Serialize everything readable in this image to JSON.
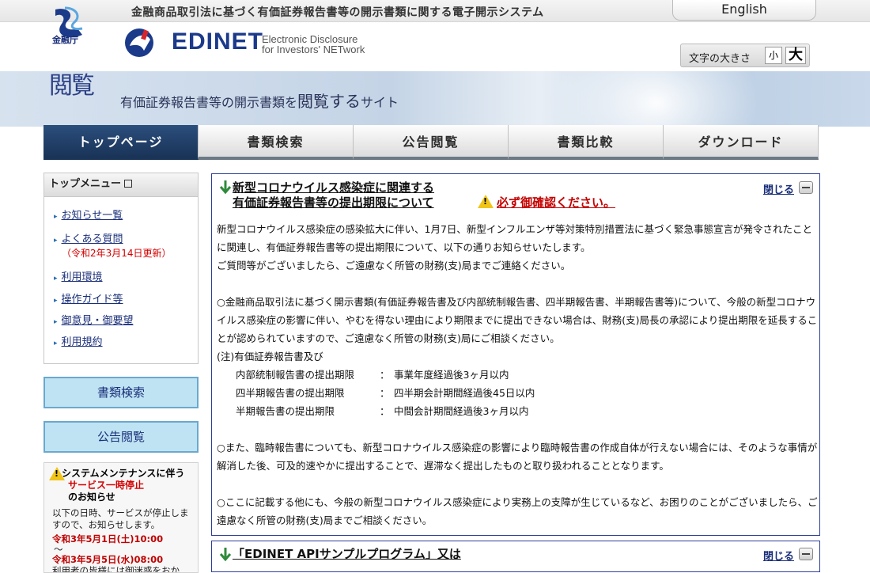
{
  "header": {
    "system_title": "金融商品取引法に基づく有価証券報告書等の開示書類に関する電子開示システム",
    "fsa_label": "金融庁",
    "logo_name": "EDINET",
    "logo_sub_line1": "Electronic Disclosure",
    "logo_sub_line2": "for Investors' NETwork",
    "english_link": "English",
    "font_size_label": "文字の大きさ",
    "font_small": "小",
    "font_large": "大"
  },
  "banner": {
    "kanji": "閲覧",
    "tagline_pre": "有価証券報告書等の開示書類を",
    "tagline_big": "閲覧する",
    "tagline_post": "サイト"
  },
  "nav": {
    "tabs": [
      "トップページ",
      "書類検索",
      "公告閲覧",
      "書類比較",
      "ダウンロード"
    ]
  },
  "sidebar": {
    "top_menu_title": "トップメニュー",
    "items": [
      "お知らせ一覧",
      "よくある質問",
      "利用環境",
      "操作ガイド等",
      "御意見・御要望",
      "利用規約"
    ],
    "faq_note": "（令和2年3月14日更新）",
    "search_button": "書類検索",
    "koukoku_button": "公告閲覧",
    "maintenance": {
      "title1": "システムメンテナンスに伴う",
      "title2": "サービス一時停止",
      "title3": "のお知らせ",
      "body": "以下の日時、サービスが停止しますので、お知らせします。",
      "date1": "令和3年5月1日(土)10:00",
      "tilde": "～",
      "date2": "令和3年5月5日(水)08:00",
      "tail": "利用者の皆様には御迷惑をおか"
    }
  },
  "notice1": {
    "title_line1": "新型コロナウイルス感染症に関連する",
    "title_line2": "有価証券報告書等の提出期限について",
    "confirm": "必ず御確認ください。",
    "close": "閉じる",
    "para1": "新型コロナウイルス感染症の感染拡大に伴い、1月7日、新型インフルエンザ等対策特別措置法に基づく緊急事態宣言が発令されたことに関連し、有価証券報告書等の提出期限について、以下の通りお知らせいたします。",
    "para1b": "ご質問等がございましたら、ご遠慮なく所管の財務(支)局までご連絡ください。",
    "para2": "○金融商品取引法に基づく開示書類(有価証券報告書及び内部統制報告書、四半期報告書、半期報告書等)について、今般の新型コロナウイルス感染症の影響に伴い、やむを得ない理由により期限までに提出できない場合は、財務(支)局長の承認により提出期限を延長することが認められていますので、ご遠慮なく所管の財務(支)局にご相談ください。",
    "note_head": "(注)有価証券報告書及び",
    "deadlines": [
      {
        "label": "内部統制報告書の提出期限",
        "colon": "：",
        "value": "事業年度経過後3ヶ月以内"
      },
      {
        "label": "四半期報告書の提出期限",
        "colon": "：",
        "value": "四半期会計期間経過後45日以内"
      },
      {
        "label": "半期報告書の提出期限",
        "colon": "：",
        "value": "中間会計期間経過後3ヶ月以内"
      }
    ],
    "para3": "○また、臨時報告書についても、新型コロナウイルス感染症の影響により臨時報告書の作成自体が行えない場合には、そのような事情が解消した後、可及的速やかに提出することで、遅滞なく提出したものと取り扱われることとなります。",
    "para4": "○ここに記載する他にも、今般の新型コロナウイルス感染症により実務上の支障が生じているなど、お困りのことがございましたら、ご遠慮なく所管の財務(支)局までご相談ください。"
  },
  "notice2": {
    "title_line1": "「EDINET APIサンプルプログラム」又は",
    "close": "閉じる"
  },
  "colors": {
    "brand_blue": "#1b3a8a",
    "nav_active": "#1a3458",
    "alert_red": "#c40000",
    "side_button_bg": "#bfe3f3"
  }
}
